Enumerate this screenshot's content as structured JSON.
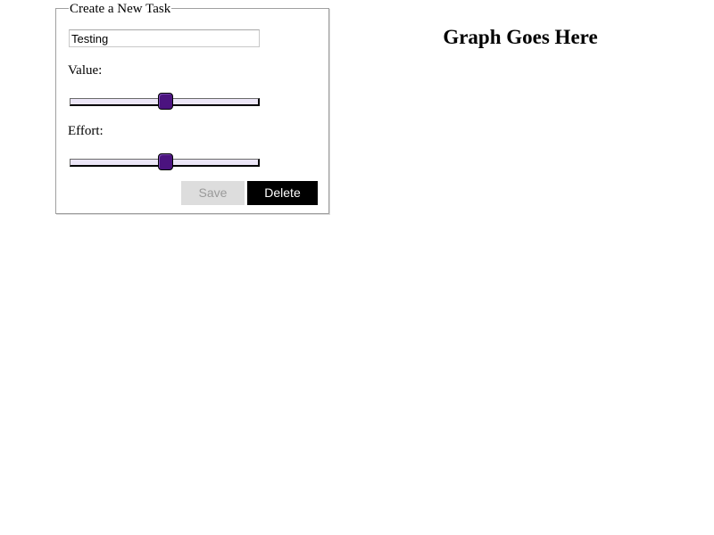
{
  "form": {
    "legend": "Create a New Task",
    "task_name": {
      "value": "Testing",
      "placeholder": ""
    },
    "value_slider": {
      "label": "Value:",
      "fraction": 0.5
    },
    "effort_slider": {
      "label": "Effort:",
      "fraction": 0.5
    },
    "save_label": "Save",
    "delete_label": "Delete"
  },
  "graph": {
    "placeholder_text": "Graph Goes Here"
  },
  "colors": {
    "slider_thumb": "#4b137f",
    "slider_track": "#ece6f7",
    "delete_button_bg": "#000000",
    "save_button_bg": "#dddddd"
  }
}
